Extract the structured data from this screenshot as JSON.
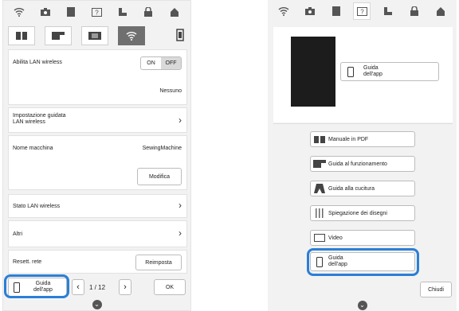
{
  "left_screen": {
    "wlan_enable_label": "Abilita LAN wireless",
    "wlan_on": "ON",
    "wlan_off": "OFF",
    "network_value": "Nessuno",
    "guided_setup_label": "Impostazione guidata\nLAN wireless",
    "machine_name_label": "Nome macchina",
    "machine_name_value": "SewingMachine",
    "modify_button": "Modifica",
    "wlan_status_label": "Stato LAN wireless",
    "others_label": "Altri",
    "reset_label": "Resett. rete",
    "reset_button": "Reimposta",
    "app_guide_button": "Guida\ndell'app",
    "page_indicator": "1 / 12",
    "ok_button": "OK"
  },
  "right_screen": {
    "app_guide_button": "Guida\ndell'app",
    "menu_items": [
      "Manuale in PDF",
      "Guida al funzionamento",
      "Guida alla cucitura",
      "Spiegazione dei disegni",
      "Video",
      "Guida\ndell'app"
    ],
    "close_button": "Chiudi"
  },
  "colors": {
    "highlight": "#2a7fd6"
  }
}
